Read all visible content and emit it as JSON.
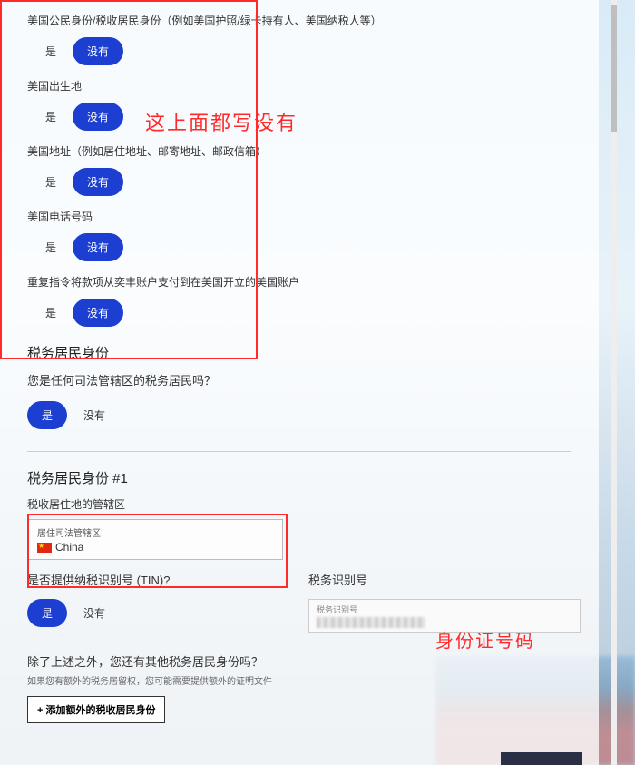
{
  "questions": [
    {
      "label": "美国公民身份/税收居民身份（例如美国护照/绿卡持有人、美国纳税人等）",
      "yes": "是",
      "no": "没有",
      "sel": "no"
    },
    {
      "label": "美国出生地",
      "yes": "是",
      "no": "没有",
      "sel": "no"
    },
    {
      "label": "美国地址（例如居住地址、邮寄地址、邮政信箱）",
      "yes": "是",
      "no": "没有",
      "sel": "no"
    },
    {
      "label": "美国电话号码",
      "yes": "是",
      "no": "没有",
      "sel": "no"
    },
    {
      "label": "重复指令将款项从奕丰账户支付到在美国开立的美国账户",
      "yes": "是",
      "no": "没有",
      "sel": "no"
    }
  ],
  "anno": {
    "top": "这上面都写没有",
    "id": "身份证号码"
  },
  "taxres": {
    "title": "税务居民身份",
    "q": "您是任何司法管辖区的税务居民吗？",
    "yes": "是",
    "no": "没有"
  },
  "sec1": {
    "title": "税务居民身份 #1",
    "jurlabel": "税收居住地的管辖区",
    "jhint": "居住司法管辖区",
    "jval": "China",
    "tinq": "是否提供纳税识别号 (TIN)?",
    "yes": "是",
    "no": "没有",
    "tinlabel": "税务识别号",
    "tinhint": "税务识别号"
  },
  "more": {
    "q": "除了上述之外，您还有其他税务居民身份吗？",
    "d": "如果您有额外的税务居留权，您可能需要提供额外的证明文件",
    "btn": "+ 添加额外的税收居民身份"
  }
}
